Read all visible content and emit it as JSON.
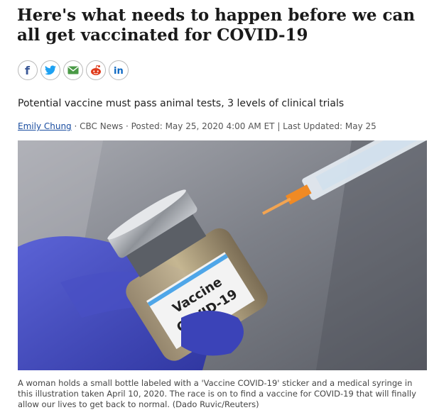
{
  "article": {
    "headline": "Here's what needs to happen before we can all get vaccinated for COVID-19",
    "deck": "Potential vaccine must pass animal tests, 3 levels of clinical trials",
    "byline": {
      "author": "Emily Chung",
      "separator1": " · ",
      "outlet": "CBC News",
      "separator2": " · ",
      "posted": "Posted: May 25, 2020 4:00 AM ET",
      "separator3": " | ",
      "updated": "Last Updated: May 25"
    },
    "photo": {
      "bottle_label_line1": "Vaccine",
      "bottle_label_line2": "COVID-19"
    },
    "caption": "A woman holds a small bottle labeled with a 'Vaccine COVID-19' sticker and a medical syringe in this illustration taken April 10, 2020. The race is on to find a vaccine for COVID-19 that will finally allow our lives to get back to normal. (Dado Ruvic/Reuters)"
  },
  "share": {
    "icons": [
      "facebook-icon",
      "twitter-icon",
      "email-icon",
      "reddit-icon",
      "linkedin-icon"
    ],
    "colors": {
      "facebook": "#3b5998",
      "twitter": "#1da1f2",
      "email": "#4a9a46",
      "reddit": "#e03a1b",
      "linkedin": "#0a66c2"
    }
  }
}
